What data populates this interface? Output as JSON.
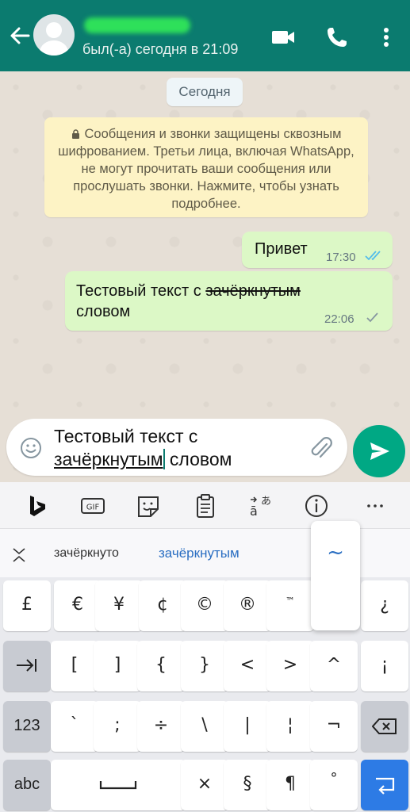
{
  "header": {
    "status": "был(-а) сегодня в 21:09",
    "bg_color": "#0b7b6f",
    "icons": [
      "back-arrow-icon",
      "video-call-icon",
      "phone-icon",
      "more-icon"
    ]
  },
  "chat": {
    "date_pill": "Сегодня",
    "encryption_notice": "Сообщения и звонки защищены сквозным шифрованием. Третьи лица, включая WhatsApp, не могут прочитать ваши сообщения или прослушать звонки. Нажмите, чтобы узнать подробнее.",
    "messages": [
      {
        "text": "Привет",
        "time": "17:30",
        "status": "read"
      },
      {
        "text_before": "Тестовый текст с ",
        "text_strike": "зачёркнутым",
        "text_after": "словом",
        "time": "22:06",
        "status": "sent"
      }
    ]
  },
  "composer": {
    "line1": "Тестовый текст с",
    "underlined_word": "зачёркнутым",
    "after_caret": " словом"
  },
  "keyboard": {
    "toolbar_icons": [
      "bing-icon",
      "gif-icon",
      "sticker-icon",
      "clipboard-icon",
      "translate-icon",
      "info-icon",
      "more-horizontal-icon"
    ],
    "gif_label": "GIF",
    "suggestions": [
      "зачёркнуто",
      "зачёркнутым"
    ],
    "popup_char": "~",
    "row1": [
      "£",
      "€",
      "¥",
      "¢",
      "©",
      "®",
      "™",
      "",
      "¿"
    ],
    "row2": [
      "[",
      "]",
      "{",
      "}",
      "<",
      ">",
      "^",
      "¡"
    ],
    "row3_label": "123",
    "row3": [
      "`",
      ";",
      "÷",
      "\\",
      "|",
      "¦",
      "¬"
    ],
    "row4_label": "abc",
    "row4": [
      "×",
      "§",
      "¶",
      "°"
    ]
  }
}
